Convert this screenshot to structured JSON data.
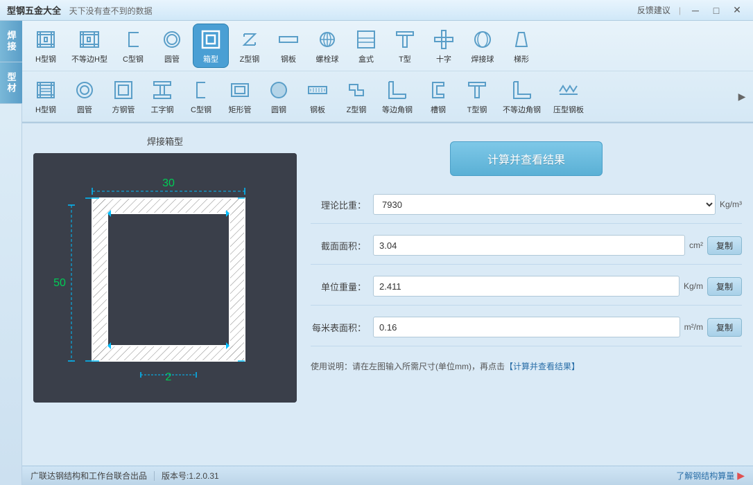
{
  "titlebar": {
    "app_name": "型钢五金大全",
    "slogan": "天下没有查不到的数据",
    "feedback": "反馈建议",
    "min_btn": "─",
    "max_btn": "□",
    "close_btn": "✕"
  },
  "sidebar": {
    "tab_welding": "焊接",
    "tab_profile": "型材"
  },
  "welding_row": {
    "items": [
      {
        "id": "h-steel",
        "label": "H型钢"
      },
      {
        "id": "unequal-h",
        "label": "不等边H型"
      },
      {
        "id": "c-steel",
        "label": "C型钢"
      },
      {
        "id": "round-tube",
        "label": "圆管"
      },
      {
        "id": "box",
        "label": "箱型"
      },
      {
        "id": "z-steel",
        "label": "Z型钢"
      },
      {
        "id": "steel-plate",
        "label": "钢板"
      },
      {
        "id": "bolt-ball",
        "label": "螺栓球"
      },
      {
        "id": "box-type",
        "label": "盒式"
      },
      {
        "id": "t-type",
        "label": "T型"
      },
      {
        "id": "cross",
        "label": "十字"
      },
      {
        "id": "weld-ball",
        "label": "焊接球"
      },
      {
        "id": "trapezoid",
        "label": "梯形"
      }
    ]
  },
  "profile_row": {
    "items": [
      {
        "id": "h-steel2",
        "label": "H型钢"
      },
      {
        "id": "round-tube2",
        "label": "圆管"
      },
      {
        "id": "square-tube",
        "label": "方钢管"
      },
      {
        "id": "i-beam",
        "label": "工字钢"
      },
      {
        "id": "c-steel2",
        "label": "C型钢"
      },
      {
        "id": "rect-tube",
        "label": "矩形管"
      },
      {
        "id": "round-steel",
        "label": "圆钢"
      },
      {
        "id": "steel-plate2",
        "label": "钢板"
      },
      {
        "id": "z-steel2",
        "label": "Z型钢"
      },
      {
        "id": "equal-angle",
        "label": "等边角钢"
      },
      {
        "id": "channel",
        "label": "槽钢"
      },
      {
        "id": "t-steel",
        "label": "T型钢"
      },
      {
        "id": "unequal-angle",
        "label": "不等边角钢"
      },
      {
        "id": "press-plate",
        "label": "压型钢板"
      }
    ],
    "scroll_icon": "▶"
  },
  "work_area": {
    "drawing_title": "焊接箱型",
    "dimensions": {
      "width": "30",
      "height": "50",
      "thickness": "2"
    }
  },
  "input_panel": {
    "calc_button": "计算并查看结果",
    "fields": [
      {
        "id": "density",
        "label": "理论比重：",
        "value": "7930",
        "unit": "Kg/m³",
        "type": "dropdown",
        "has_copy": false
      },
      {
        "id": "area",
        "label": "截面面积：",
        "value": "3.04",
        "unit": "cm²",
        "type": "text",
        "has_copy": true,
        "copy_label": "复制"
      },
      {
        "id": "unit-weight",
        "label": "单位重量：",
        "value": "2.411",
        "unit": "Kg/m",
        "type": "text",
        "has_copy": true,
        "copy_label": "复制"
      },
      {
        "id": "surface-area",
        "label": "每米表面积：",
        "value": "0.16",
        "unit": "m²/m",
        "type": "text",
        "has_copy": true,
        "copy_label": "复制"
      }
    ],
    "usage_note": "使用说明：请在左图输入所需尺寸(单位mm)，再点击【计算并查看结果】"
  },
  "statusbar": {
    "company": "广联达钢结构和工作台联合出品",
    "version_label": "版本号:1.2.0.31",
    "right_link": "了解钢结构算量"
  }
}
